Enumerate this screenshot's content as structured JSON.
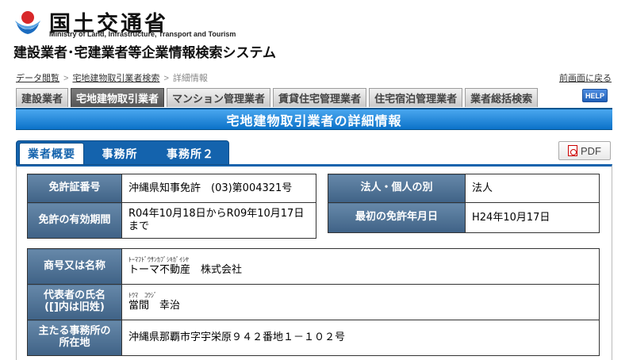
{
  "header": {
    "ministry_jp": "国土交通省",
    "ministry_en": "Ministry of Land, Infrastructure, Transport and Tourism",
    "system_title": "建設業者･宅建業者等企業情報検索システム"
  },
  "breadcrumb": {
    "items": [
      "データ閲覧",
      "宅地建物取引業者検索"
    ],
    "current": "詳細情報",
    "separator": ">"
  },
  "back_link": "前画面に戻る",
  "top_tabs": [
    {
      "label": "建設業者",
      "active": false
    },
    {
      "label": "宅地建物取引業者",
      "active": true
    },
    {
      "label": "マンション管理業者",
      "active": false
    },
    {
      "label": "賃貸住宅管理業者",
      "active": false
    },
    {
      "label": "住宅宿泊管理業者",
      "active": false
    },
    {
      "label": "業者総括検索",
      "active": false
    }
  ],
  "help_label": "HELP",
  "page_title": "宅地建物取引業者の詳細情報",
  "sub_tabs": [
    {
      "label": "業者概要",
      "active": true
    },
    {
      "label": "事務所",
      "active": false
    },
    {
      "label": "事務所２",
      "active": false
    }
  ],
  "pdf_label": "PDF",
  "license": {
    "number_label": "免許証番号",
    "number_value": "沖縄県知事免許　(03)第004321号",
    "validity_label": "免許の有効期間",
    "validity_value": "R04年10月18日からR09年10月17日まで"
  },
  "corp": {
    "type_label": "法人・個人の別",
    "type_value": "法人",
    "first_license_label": "最初の免許年月日",
    "first_license_value": "H24年10月17日"
  },
  "company": {
    "name_label": "商号又は名称",
    "name_kana": "ﾄｰﾏﾌﾄﾞｳｻﾝｶﾌﾞｼｷｶﾞｲｼﾔ",
    "name_value": "トーマ不動産　株式会社",
    "rep_label_line1": "代表者の氏名",
    "rep_label_line2": "([]内は旧姓)",
    "rep_kana": "ﾄｳﾏ　ｺｳｼﾞ",
    "rep_value": "當間　幸治",
    "office_label_line1": "主たる事務所の",
    "office_label_line2": "所在地",
    "office_value": "沖縄県那覇市字宇栄原９４２番地１－１０２号"
  },
  "colors": {
    "title_band": "#0b72c9",
    "sub_tab_bar": "#1463ad",
    "table_header": "#4f7297"
  }
}
